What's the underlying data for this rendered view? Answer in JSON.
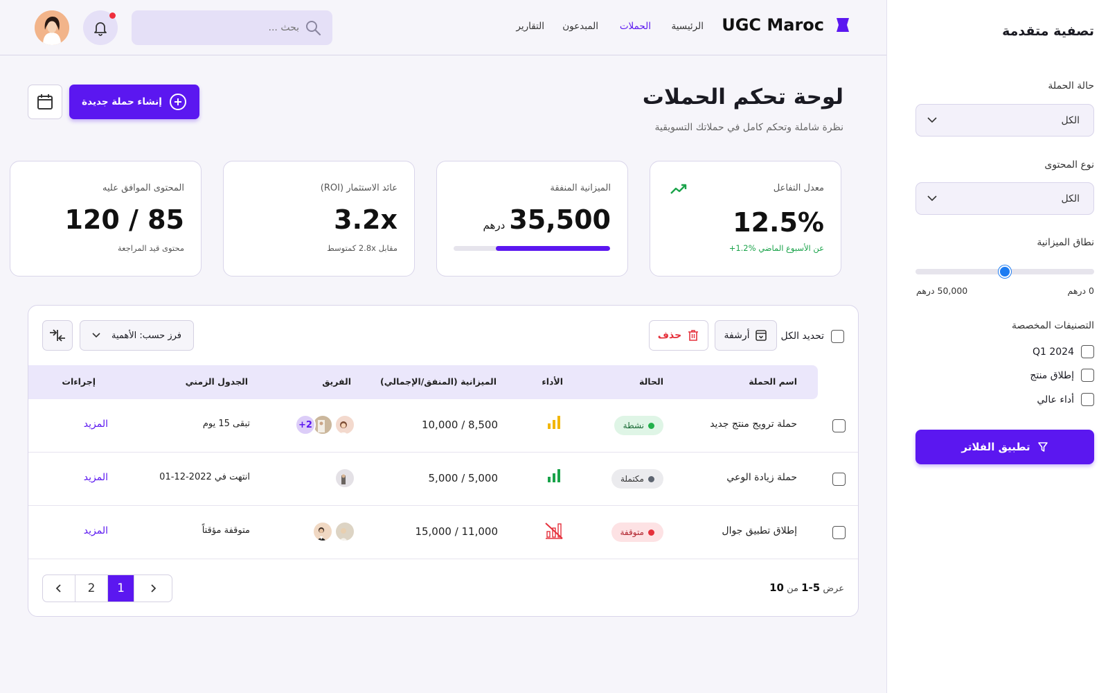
{
  "header": {
    "brand": "UGC Maroc",
    "nav": [
      "الرئيسية",
      "الحملات",
      "المبدعون",
      "التقارير"
    ],
    "active_nav": "الحملات",
    "search_placeholder": "بحث ..."
  },
  "page": {
    "title": "لوحة تحكم الحملات",
    "subtitle": "نظرة شاملة وتحكم كامل في حملاتك التسويقية",
    "create_button": "إنشاء حملة جديدة"
  },
  "cards": {
    "engagement": {
      "label": "معدل التفاعل",
      "value": "12.5%",
      "sub": "+1.2% عن الأسبوع الماضي"
    },
    "budget": {
      "label": "الميزانية المنفقة",
      "value": "35,500",
      "unit": "درهم",
      "progress": 0.73
    },
    "roi": {
      "label": "عائد الاستثمار (ROI)",
      "value": "3.2x",
      "sub": "مقابل 2.8x كمتوسط"
    },
    "approved": {
      "label": "المحتوى الموافق عليه",
      "value": "120 / 85",
      "sub": "محتوى قيد المراجعة"
    }
  },
  "table": {
    "select_all": "تحديد الكل",
    "archive": "أرشفة",
    "delete": "حذف",
    "sort": "فرز حسب: الأهمية",
    "columns": [
      "اسم الحملة",
      "الحالة",
      "الأداء",
      "الميزانية (المنفق/الإجمالي)",
      "الفريق",
      "الجدول الزمني",
      "إجراءات"
    ],
    "rows": [
      {
        "name": "حملة ترويج منتج جديد",
        "status": "نشطة",
        "budget": "10,000 / 8,500",
        "team_extra": "+2",
        "timeline": "تبقى 15 يوم",
        "action": "المزيد"
      },
      {
        "name": "حملة زيادة الوعي",
        "status": "مكتملة",
        "budget": "5,000 / 5,000",
        "timeline": "انتهت في 2022-12-01",
        "action": "المزيد"
      },
      {
        "name": "إطلاق تطبيق جوال",
        "status": "متوقفة",
        "budget": "15,000 / 11,000",
        "timeline": "متوقفة مؤقتاً",
        "action": "المزيد"
      }
    ],
    "showing_prefix": "عرض",
    "showing_range": "1-5",
    "showing_of": "من",
    "showing_total": "10",
    "pages": [
      "1",
      "2"
    ]
  },
  "filters": {
    "title": "تصفية متقدمة",
    "status_label": "حالة الحملة",
    "status_value": "الكل",
    "content_label": "نوع المحتوى",
    "content_value": "الكل",
    "budget_label": "نطاق الميزانية",
    "budget_min": "0 درهم",
    "budget_max": "50,000 درهم",
    "budget_level": 0.5,
    "tags_label": "التصنيفات المخصصة",
    "tags": [
      "Q1 2024",
      "إطلاق منتج",
      "أداء عالي"
    ],
    "apply": "تطبيق الفلاتر"
  },
  "colors": {
    "primary": "#5b17f0",
    "green": "#1aa34a",
    "red": "#e5303b",
    "yellow": "#f2b705"
  }
}
